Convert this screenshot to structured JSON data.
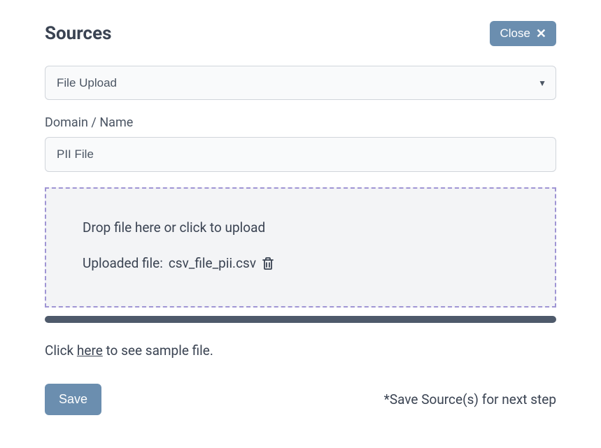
{
  "header": {
    "title": "Sources",
    "close_label": "Close"
  },
  "source_type": {
    "selected": "File Upload"
  },
  "domain_field": {
    "label": "Domain / Name",
    "value": "PII File"
  },
  "dropzone": {
    "instruction": "Drop file here or click to upload",
    "uploaded_prefix": "Uploaded file: ",
    "uploaded_filename": "csv_file_pii.csv"
  },
  "sample": {
    "prefix": "Click ",
    "link": "here",
    "suffix": " to see sample file."
  },
  "footer": {
    "save_label": "Save",
    "hint": "*Save Source(s) for next step"
  }
}
